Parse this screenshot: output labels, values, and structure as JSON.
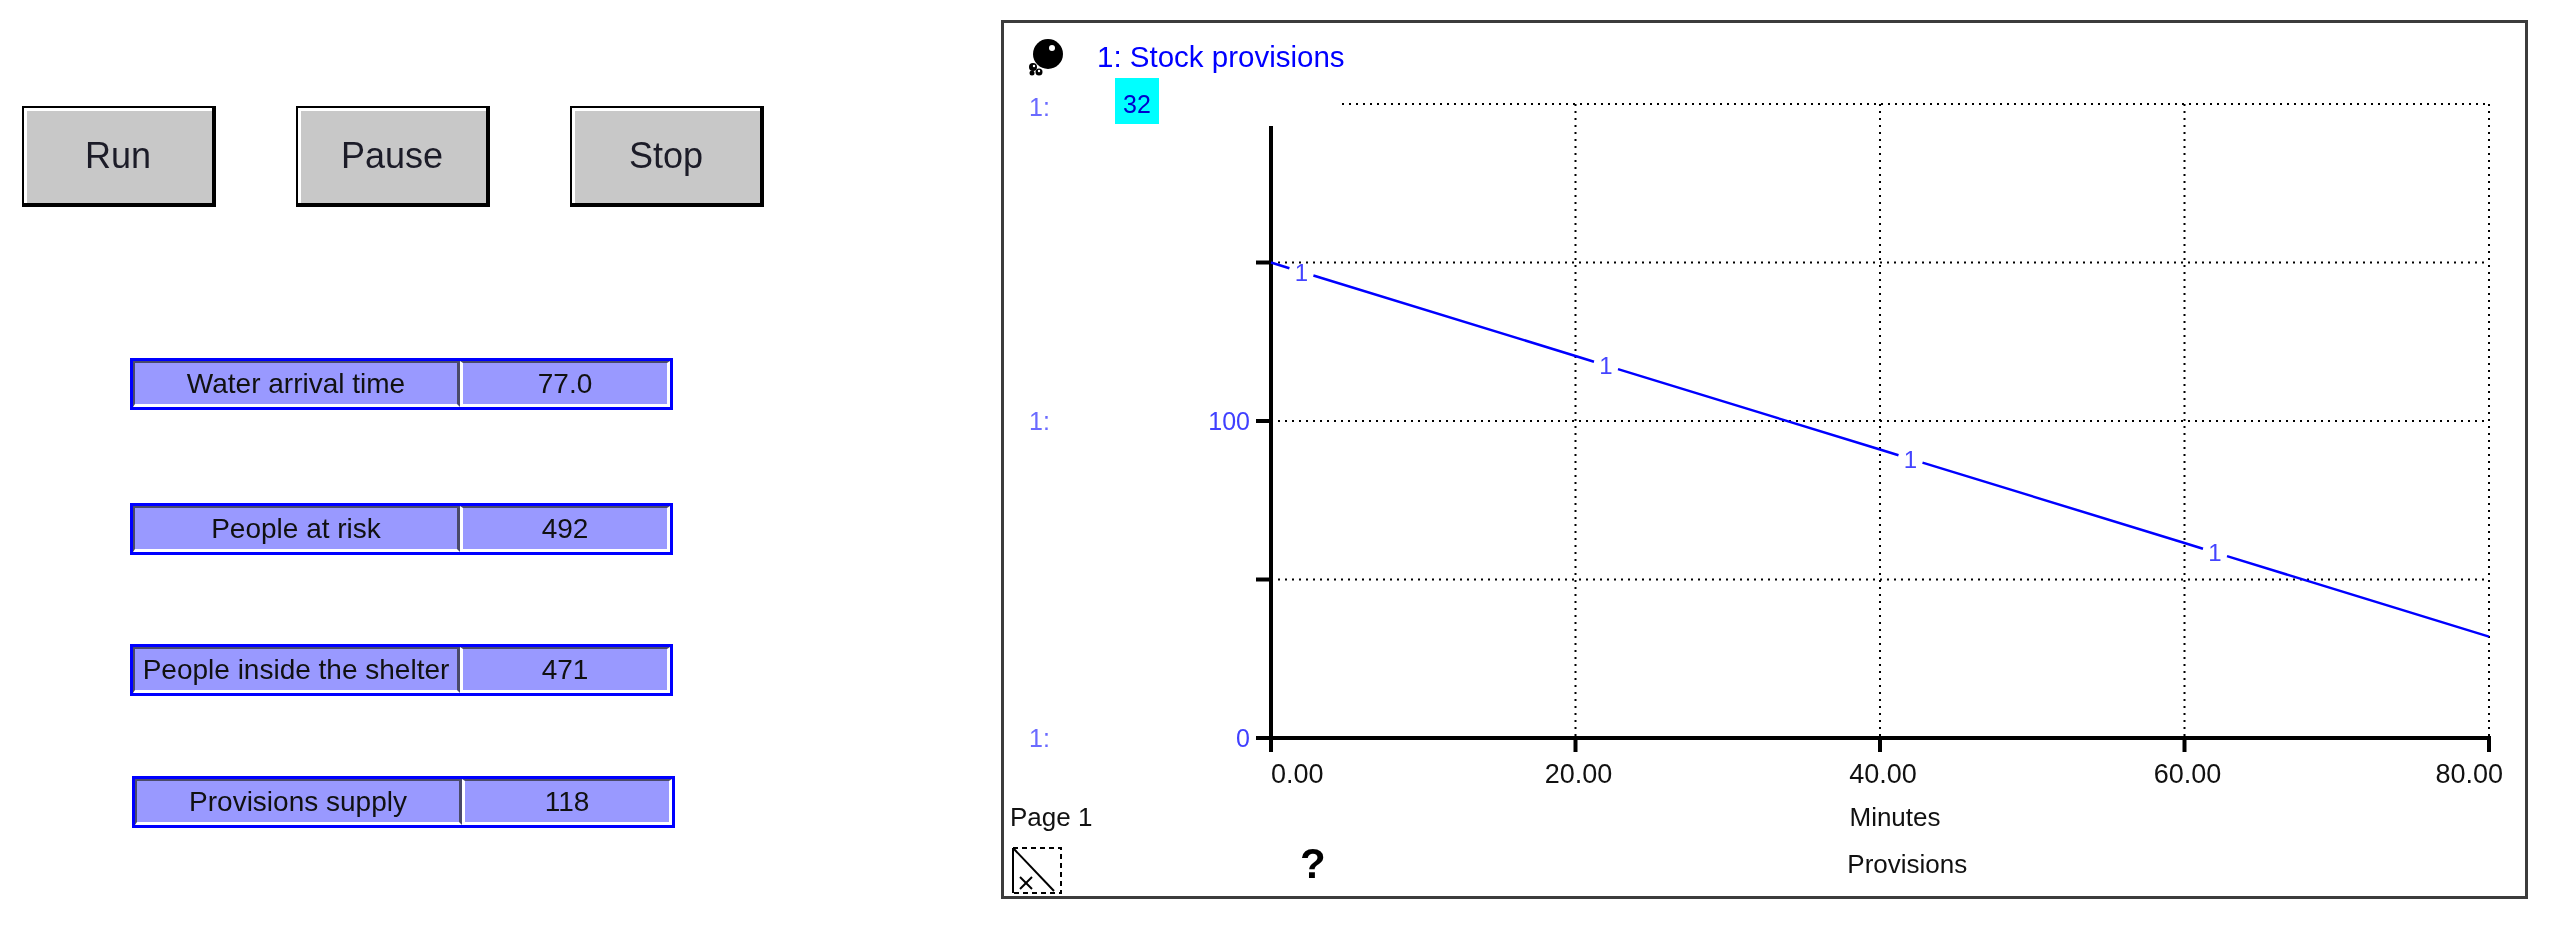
{
  "buttons": [
    "Run",
    "Pause",
    "Stop"
  ],
  "displays": [
    {
      "label": "Water arrival time",
      "value": "77.0"
    },
    {
      "label": "People at risk",
      "value": "492"
    },
    {
      "label": "People inside the shelter",
      "value": "471"
    },
    {
      "label": "Provisions supply",
      "value": "118"
    }
  ],
  "graph": {
    "readout": {
      "label": "1:",
      "value": "32",
      "highlighted": true
    },
    "scale_labels": [
      "1:",
      "1:"
    ],
    "page_label": "Page 1",
    "help_glyph": "?",
    "chart_data": {
      "type": "line",
      "title": "Provisions",
      "xlabel": "Minutes",
      "x": [
        0,
        20,
        40,
        60,
        80
      ],
      "series": [
        {
          "name": "1: Stock provisions",
          "color": "#0000ff",
          "values": [
            150,
            120.5,
            91,
            61.5,
            32
          ]
        }
      ],
      "xlim": [
        0,
        80
      ],
      "ylim": [
        0,
        200
      ],
      "xticks": [
        {
          "value": 0,
          "label": "0.00"
        },
        {
          "value": 20,
          "label": "20.00"
        },
        {
          "value": 40,
          "label": "40.00"
        },
        {
          "value": 60,
          "label": "60.00"
        },
        {
          "value": 80,
          "label": "80.00"
        }
      ],
      "yticks": [
        100,
        0
      ],
      "grid": true,
      "annotations": [
        "1",
        "1",
        "1",
        "1"
      ]
    }
  }
}
